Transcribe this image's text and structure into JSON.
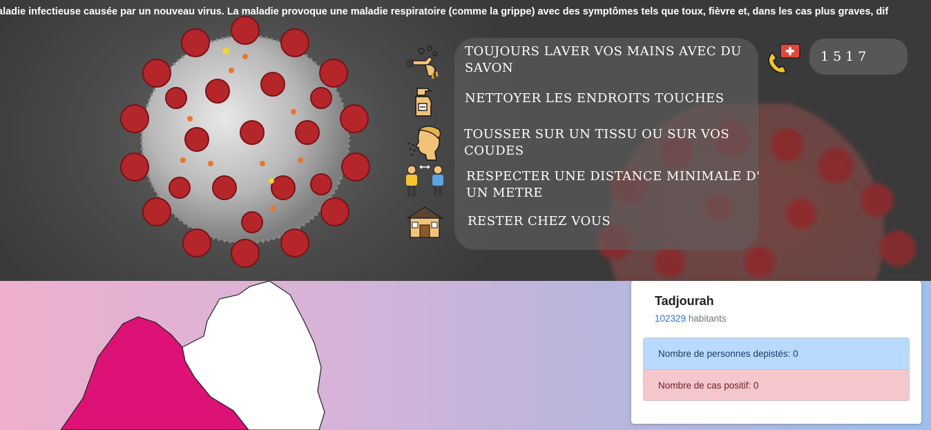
{
  "banner": {
    "marquee_text": "aladie infectieuse causée par un nouveau virus. La maladie provoque une maladie respiratoire (comme la grippe) avec des symptômes tels que toux, fièvre et, dans les cas plus graves, dif"
  },
  "prevention": {
    "tips": [
      {
        "icon": "hand-washing-icon",
        "text": "Toujours laver vos mains avec du savon"
      },
      {
        "icon": "spray-bottle-icon",
        "text": "Nettoyer les endroits touches"
      },
      {
        "icon": "cough-icon",
        "text": "Tousser sur un tissu ou sur vos coudes"
      },
      {
        "icon": "social-distance-icon",
        "text": "Respecter une distance minimale d' un metre"
      },
      {
        "icon": "stay-home-icon",
        "text": "Rester chez vous"
      }
    ]
  },
  "hotline": {
    "icon": "emergency-phone-icon",
    "number": "1517"
  },
  "region": {
    "name": "Tadjourah",
    "population": "102329",
    "population_suffix": " habitants",
    "tested_label": "Nombre de personnes depistés: 0",
    "positive_label": "Nombre de cas positif: 0",
    "highlight_color": "#dc1277"
  },
  "colors": {
    "tested_bg": "#b8dafe",
    "positive_bg": "#f5c6cb",
    "virus_red": "#b5262b"
  }
}
